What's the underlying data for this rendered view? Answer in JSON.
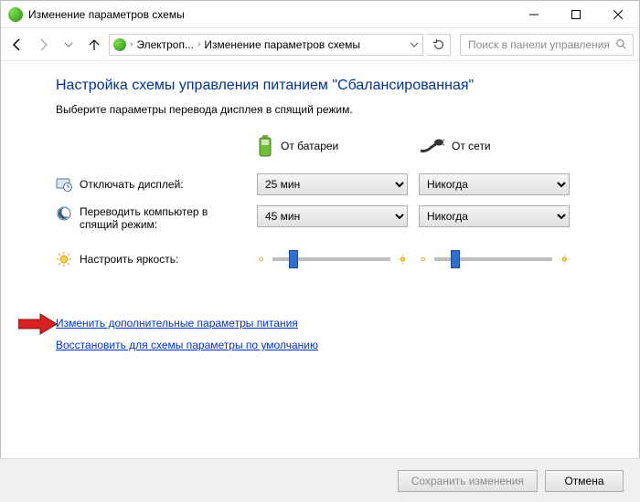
{
  "window": {
    "title": "Изменение параметров схемы"
  },
  "breadcrumb": {
    "item1": "Электроп...",
    "item2": "Изменение параметров схемы"
  },
  "search": {
    "placeholder": "Поиск в панели управления"
  },
  "heading": "Настройка схемы управления питанием \"Сбалансированная\"",
  "sub": "Выберите параметры перевода дисплея в спящий режим.",
  "columns": {
    "battery": "От батареи",
    "plugged": "От сети"
  },
  "rows": {
    "displayOff": "Отключать дисплей:",
    "sleep": "Переводить компьютер в спящий режим:",
    "brightness": "Настроить яркость:"
  },
  "values": {
    "displayOff_battery": "25 мин",
    "displayOff_plugged": "Никогда",
    "sleep_battery": "45 мин",
    "sleep_plugged": "Никогда",
    "brightness_battery": 15,
    "brightness_plugged": 15
  },
  "links": {
    "advanced": "Изменить дополнительные параметры питания",
    "restore": "Восстановить для схемы параметры по умолчанию"
  },
  "buttons": {
    "save": "Сохранить изменения",
    "cancel": "Отмена"
  }
}
